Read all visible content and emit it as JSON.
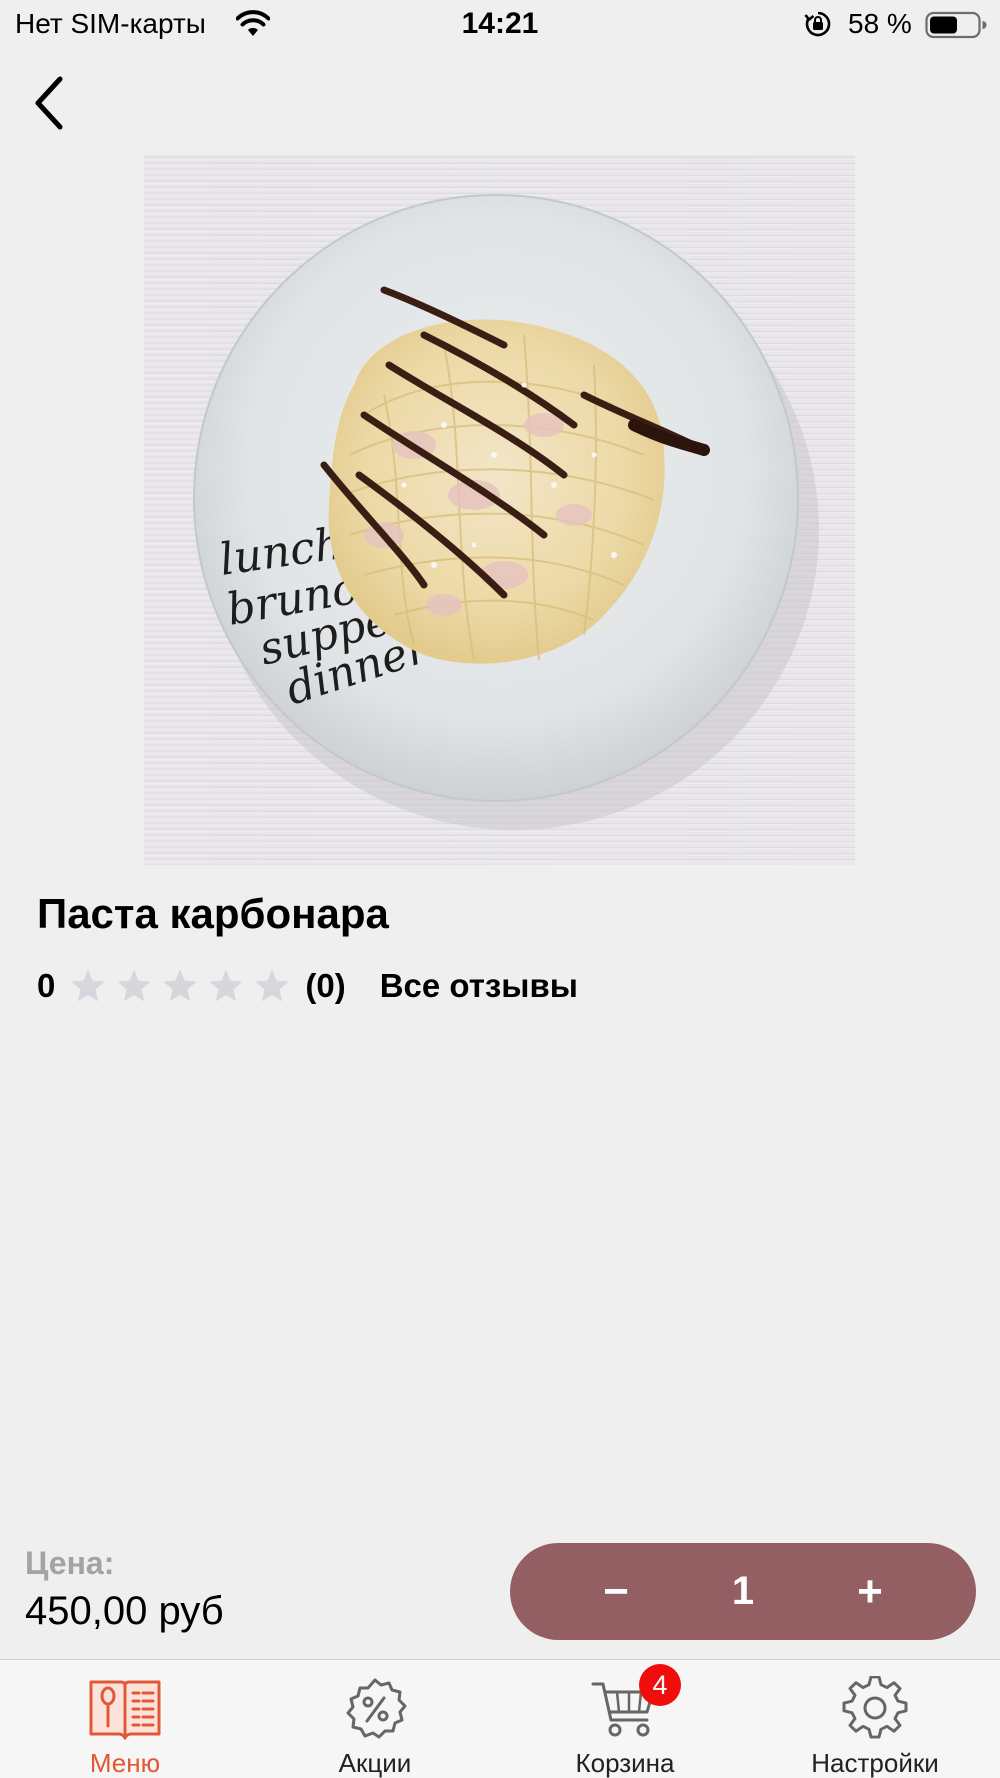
{
  "status_bar": {
    "carrier": "Нет SIM-карты",
    "time": "14:21",
    "battery_percent": "58 %"
  },
  "product": {
    "title": "Паста карбонара",
    "image_icon": "pasta-plate-photo",
    "plate_lettering": [
      "lunch",
      "brunch",
      "supper",
      "dinner"
    ],
    "rating_value": "0",
    "stars_filled": 0,
    "stars_total": 5,
    "rating_count": "(0)",
    "all_reviews_label": "Все отзывы"
  },
  "purchase": {
    "price_label": "Цена:",
    "price_value": "450,00 руб",
    "minus_label": "−",
    "quantity": "1",
    "plus_label": "+"
  },
  "tab_bar": {
    "tabs": [
      {
        "label": "Меню",
        "icon": "menu-book-icon",
        "active": true
      },
      {
        "label": "Акции",
        "icon": "discount-badge-icon",
        "active": false
      },
      {
        "label": "Корзина",
        "icon": "cart-icon",
        "active": false,
        "badge": "4"
      },
      {
        "label": "Настройки",
        "icon": "gear-icon",
        "active": false
      }
    ]
  },
  "colors": {
    "background": "#f0eff0",
    "accent_stepper": "#935f63",
    "active_tab": "#e25836",
    "badge": "#f20d0d",
    "price_label": "#a3a3a3",
    "star_empty": "#d6d6dc"
  }
}
